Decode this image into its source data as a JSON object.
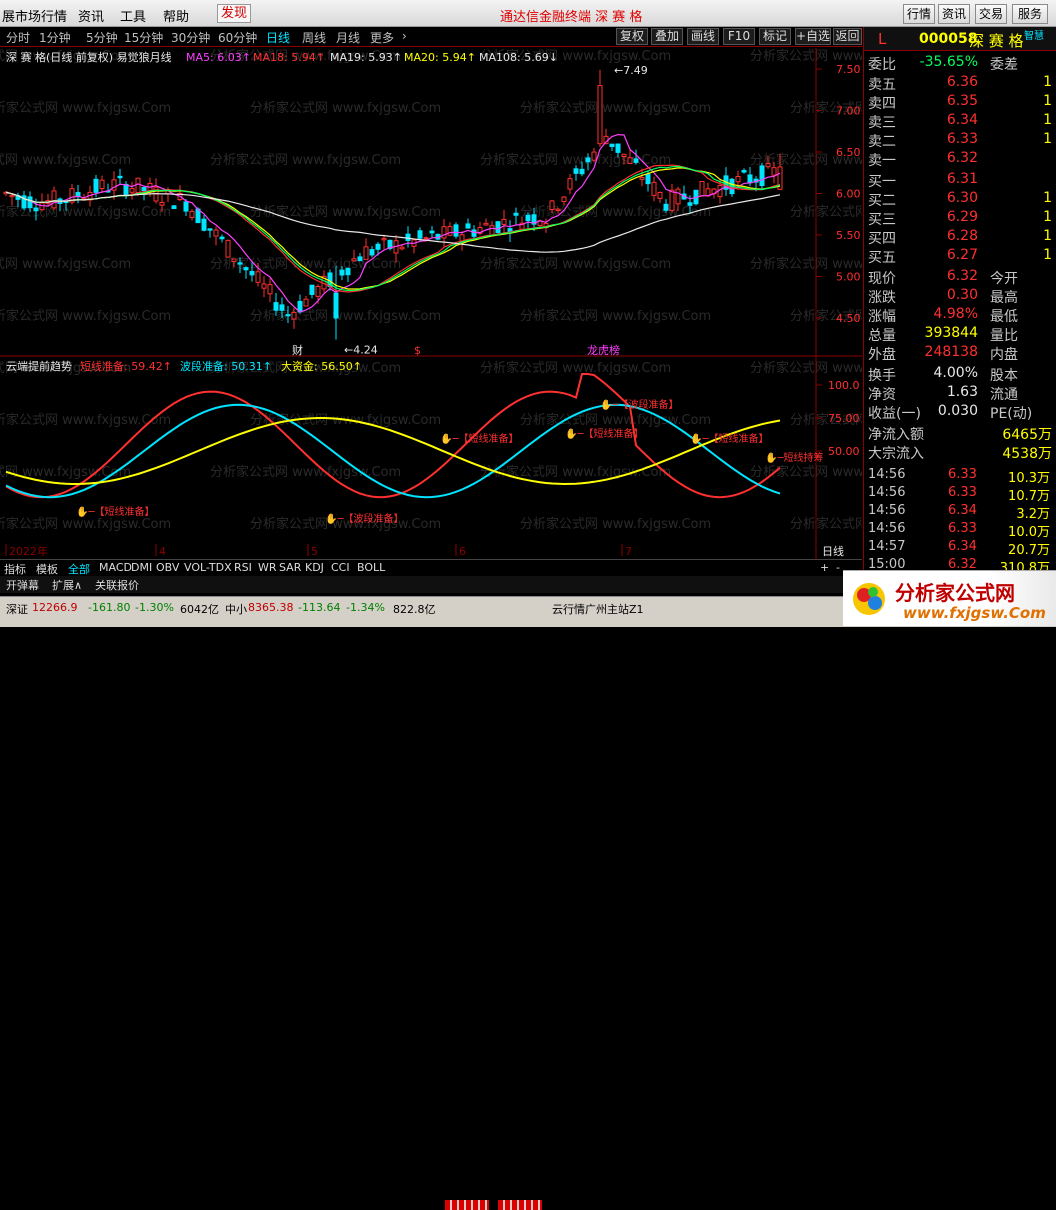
{
  "menu": {
    "items": [
      "展市场行情",
      "资讯",
      "工具",
      "帮助",
      "发现"
    ],
    "title": "通达信金融终端    深 赛 格",
    "right_buttons": [
      "行情",
      "资讯",
      "交易",
      "服务"
    ]
  },
  "periods": [
    "分时",
    "1分钟",
    "5分钟",
    "15分钟",
    "30分钟",
    "60分钟",
    "日线",
    "周线",
    "月线",
    "更多",
    "›"
  ],
  "active_period": "日线",
  "toolbar": [
    "复权",
    "叠加",
    "画线",
    "F10",
    "标记",
    "+自选",
    "返回"
  ],
  "main_legend": {
    "name": "深 赛 格(日线 前复权) 易觉狼月线",
    "items": [
      {
        "label": "MA5: 6.03↑",
        "color": "#ff40ff"
      },
      {
        "label": "MA18: 5.94↑",
        "color": "#ff3030"
      },
      {
        "label": "MA19: 5.93↑",
        "color": "#e8e8e8"
      },
      {
        "label": "MA20: 5.94↑",
        "color": "#ffff00"
      },
      {
        "label": "MA108: 5.69↓",
        "color": "#e8e8e8"
      }
    ]
  },
  "watermark": "分析家公式网 www.fxjgsw.Com",
  "price_axis": [
    "7.50",
    "7.00",
    "6.50",
    "6.00",
    "5.50",
    "5.00",
    "4.50"
  ],
  "price_annotations": {
    "high": "7.49",
    "low": "4.24"
  },
  "markers": [
    "财",
    "$",
    "龙虎榜"
  ],
  "sub_legend": {
    "name": "云端提前趋势",
    "items": [
      {
        "label": "短线准备: 59.42↑",
        "color": "#ff3030"
      },
      {
        "label": "波段准备: 50.31↑",
        "color": "#00e5ff"
      },
      {
        "label": "大资金: 56.50↑",
        "color": "#ffff00"
      }
    ]
  },
  "sub_axis": [
    "100.0",
    "75.00",
    "50.00"
  ],
  "sub_labels": {
    "short": "【短线准备】",
    "wave": "【波段准备】",
    "hold": "短线持筹"
  },
  "date_axis": [
    "2022年",
    "4",
    "5",
    "6",
    "7"
  ],
  "period_label": "日线",
  "indicator_tabs": [
    "指标",
    "模板",
    "全部",
    "MACD",
    "DMI",
    "OBV",
    "VOL-TDX",
    "RSI",
    "WR",
    "SAR",
    "KDJ",
    "CCI",
    "BOLL"
  ],
  "active_indicator_tab": "全部",
  "tabbar2": [
    "开弹幕",
    "扩展∧",
    "关联报价"
  ],
  "status": {
    "sz_label": "深证",
    "sz_value": "12266.9",
    "sz_change": "-161.80",
    "sz_pct": "-1.30%",
    "sz_amount": "6042亿",
    "zx_label": "中小",
    "zx_value": "8365.38",
    "zx_change": "-113.64",
    "zx_pct": "-1.34%",
    "zx_amount": "822.8亿",
    "server": "云行情广州主站Z1"
  },
  "quote": {
    "mark": "L",
    "code": "000058",
    "name": "深 赛 格",
    "tag": "智慧",
    "weibi_label": "委比",
    "weibi": "-35.65%",
    "weicha_label": "委差",
    "asks": [
      {
        "label": "卖五",
        "price": "6.36",
        "vol": "1"
      },
      {
        "label": "卖四",
        "price": "6.35",
        "vol": "1"
      },
      {
        "label": "卖三",
        "price": "6.34",
        "vol": "1"
      },
      {
        "label": "卖二",
        "price": "6.33",
        "vol": "1"
      },
      {
        "label": "卖一",
        "price": "6.32",
        "vol": ""
      }
    ],
    "bids": [
      {
        "label": "买一",
        "price": "6.31",
        "vol": ""
      },
      {
        "label": "买二",
        "price": "6.30",
        "vol": "1"
      },
      {
        "label": "买三",
        "price": "6.29",
        "vol": "1"
      },
      {
        "label": "买四",
        "price": "6.28",
        "vol": "1"
      },
      {
        "label": "买五",
        "price": "6.27",
        "vol": "1"
      }
    ],
    "stats": [
      {
        "k": "现价",
        "v": "6.32",
        "c": "red",
        "k2": "今开"
      },
      {
        "k": "涨跌",
        "v": "0.30",
        "c": "red",
        "k2": "最高"
      },
      {
        "k": "涨幅",
        "v": "4.98%",
        "c": "red",
        "k2": "最低"
      },
      {
        "k": "总量",
        "v": "393844",
        "c": "yel",
        "k2": "量比"
      },
      {
        "k": "外盘",
        "v": "248138",
        "c": "red",
        "k2": "内盘"
      }
    ],
    "stats2": [
      {
        "k": "换手",
        "v": "4.00%",
        "c": "wht",
        "k2": "股本"
      },
      {
        "k": "净资",
        "v": "1.63",
        "c": "wht",
        "k2": "流通"
      },
      {
        "k": "收益(一)",
        "v": "0.030",
        "c": "wht",
        "k2": "PE(动)"
      }
    ],
    "flow": [
      {
        "k": "净流入额",
        "v": "6465万"
      },
      {
        "k": "大宗流入",
        "v": "4538万"
      }
    ],
    "ticks": [
      {
        "t": "14:56",
        "p": "6.33",
        "v": "10.3万"
      },
      {
        "t": "14:56",
        "p": "6.33",
        "v": "10.7万"
      },
      {
        "t": "14:56",
        "p": "6.34",
        "v": "3.2万"
      },
      {
        "t": "14:56",
        "p": "6.33",
        "v": "10.0万"
      },
      {
        "t": "14:57",
        "p": "6.34",
        "v": "20.7万"
      },
      {
        "t": "15:00",
        "p": "6.32",
        "v": "310.8万"
      }
    ]
  },
  "logo": {
    "text": "分析家公式网",
    "url": "www.fxjgsw.Com"
  },
  "colors": {
    "up": "#ff3030",
    "down": "#00e5ff",
    "ma5": "#ff40ff",
    "ma_white": "#e8e8e8",
    "ma_yellow": "#ffff00",
    "ma_green": "#00ff60",
    "grid": "#8b0000"
  }
}
